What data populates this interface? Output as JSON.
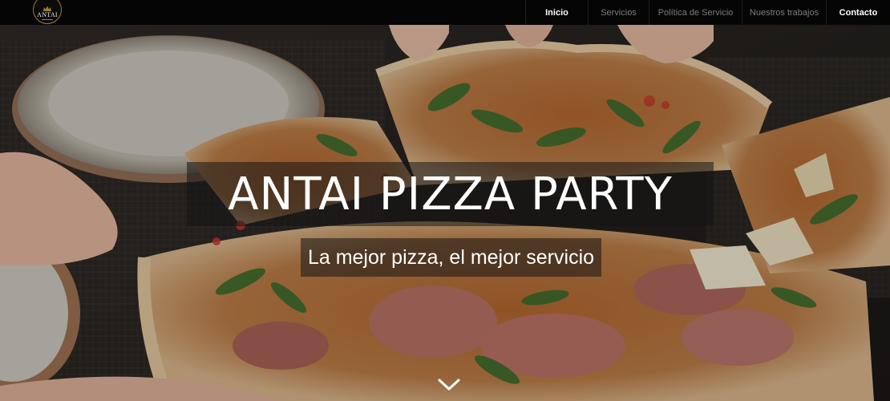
{
  "brand": {
    "name": "ANTAI"
  },
  "nav": {
    "items": [
      {
        "label": "Inicio",
        "active": true
      },
      {
        "label": "Servicios",
        "active": false
      },
      {
        "label": "Política de Servicio",
        "active": false
      },
      {
        "label": "Nuestros trabajos",
        "active": false
      },
      {
        "label": "Contacto",
        "active": true
      }
    ]
  },
  "hero": {
    "title": "ANTAI PIZZA PARTY",
    "subtitle": "La mejor pizza, el mejor servicio",
    "scroll_icon": "chevron-down-icon",
    "background": "pizza-party-photo"
  },
  "colors": {
    "nav_bg": "#050505",
    "nav_inactive": "#7d7d7d",
    "nav_active": "#ffffff",
    "logo_gold": "#9a7c3a",
    "overlay_box": "rgba(20,20,20,0.55)"
  }
}
